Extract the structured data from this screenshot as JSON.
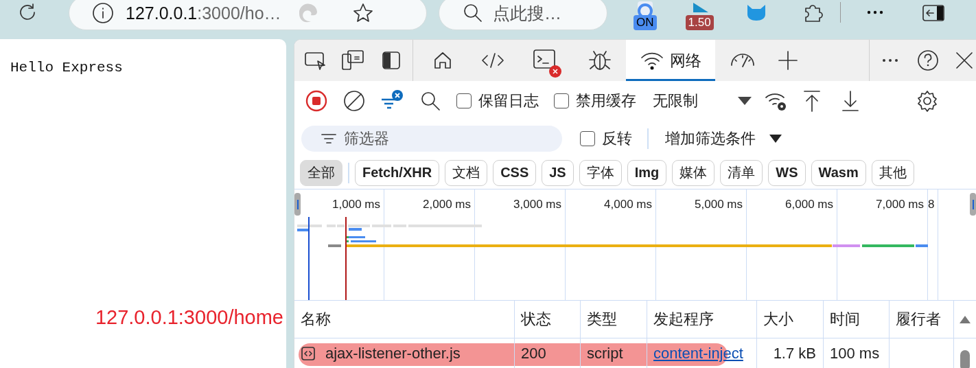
{
  "browser_toolbar": {
    "address": {
      "host": "127.0.0.1",
      "rest": ":3000/ho…"
    },
    "search": {
      "placeholder": "点此搜…"
    },
    "extensions": [
      {
        "badge": "ON",
        "color": "#4a8cf0"
      },
      {
        "badge": "1.50",
        "color": "#a84343"
      }
    ]
  },
  "page": {
    "text": "Hello Express"
  },
  "annotation": {
    "text": "127.0.0.1:3000/home"
  },
  "devtools": {
    "tabs": [
      {
        "kind": "home",
        "selected": false
      },
      {
        "kind": "code",
        "selected": false
      },
      {
        "kind": "console",
        "selected": false,
        "error_badge": true
      },
      {
        "kind": "bug",
        "selected": false
      },
      {
        "kind": "network",
        "label": "网络",
        "selected": true
      },
      {
        "kind": "gauge",
        "selected": false
      }
    ],
    "toolbar": {
      "recording": true,
      "preserve_log": {
        "label": "保留日志",
        "checked": false
      },
      "disable_cache": {
        "label": "禁用缓存",
        "checked": false
      },
      "throttling": "无限制"
    },
    "filter": {
      "placeholder": "筛选器",
      "invert": {
        "label": "反转",
        "checked": false
      },
      "more_filters": "增加筛选条件"
    },
    "types": [
      {
        "label": "全部",
        "selected": true
      },
      {
        "label": "Fetch/XHR",
        "selected": false
      },
      {
        "label": "文档",
        "selected": false
      },
      {
        "label": "CSS",
        "selected": false
      },
      {
        "label": "JS",
        "selected": false
      },
      {
        "label": "字体",
        "selected": false
      },
      {
        "label": "Img",
        "selected": false
      },
      {
        "label": "媒体",
        "selected": false
      },
      {
        "label": "清单",
        "selected": false
      },
      {
        "label": "WS",
        "selected": false
      },
      {
        "label": "Wasm",
        "selected": false
      },
      {
        "label": "其他",
        "selected": false
      }
    ],
    "timeline": {
      "ticks": [
        "1,000 ms",
        "2,000 ms",
        "3,000 ms",
        "4,000 ms",
        "5,000 ms",
        "6,000 ms",
        "7,000 ms",
        "8"
      ]
    },
    "table": {
      "columns": [
        "名称",
        "状态",
        "类型",
        "发起程序",
        "大小",
        "时间",
        "履行者"
      ],
      "rows": [
        {
          "name": "ajax-listener-other.js",
          "status": "200",
          "type": "script",
          "initiator": "content-inject",
          "size": "1.7 kB",
          "time": "100 ms",
          "highlighted": true
        }
      ]
    }
  }
}
